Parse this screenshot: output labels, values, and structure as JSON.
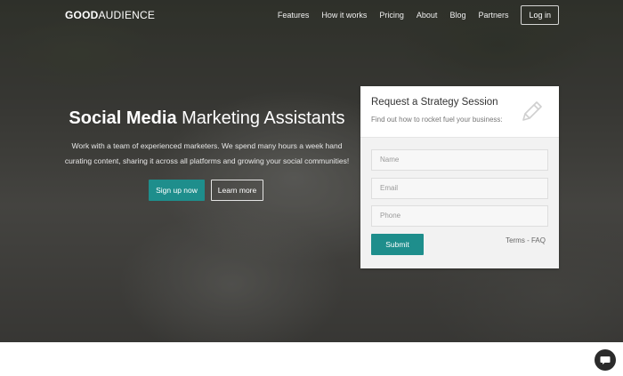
{
  "brand": {
    "bold": "GOOD",
    "light": "AUDIENCE"
  },
  "nav": {
    "items": [
      "Features",
      "How it works",
      "Pricing",
      "About",
      "Blog",
      "Partners"
    ],
    "login_label": "Log in"
  },
  "hero": {
    "headline_bold": "Social Media",
    "headline_light": "Marketing Assistants",
    "subtext": "Work with a team of experienced marketers. We spend many hours a week hand curating content, sharing it across all platforms and growing your social communities!",
    "primary_button": "Sign up now",
    "secondary_button": "Learn more"
  },
  "form": {
    "title": "Request a Strategy Session",
    "subtitle": "Find out how to rocket fuel your business:",
    "name_placeholder": "Name",
    "email_placeholder": "Email",
    "phone_placeholder": "Phone",
    "submit_label": "Submit",
    "terms_link": "Terms",
    "separator": "-",
    "faq_link": "FAQ"
  },
  "colors": {
    "accent": "#1e8e8c",
    "chat_bubble": "#2b2b2b"
  },
  "icons": {
    "form_icon": "pencil-icon",
    "chat_icon": "chat-bubble-icon"
  }
}
